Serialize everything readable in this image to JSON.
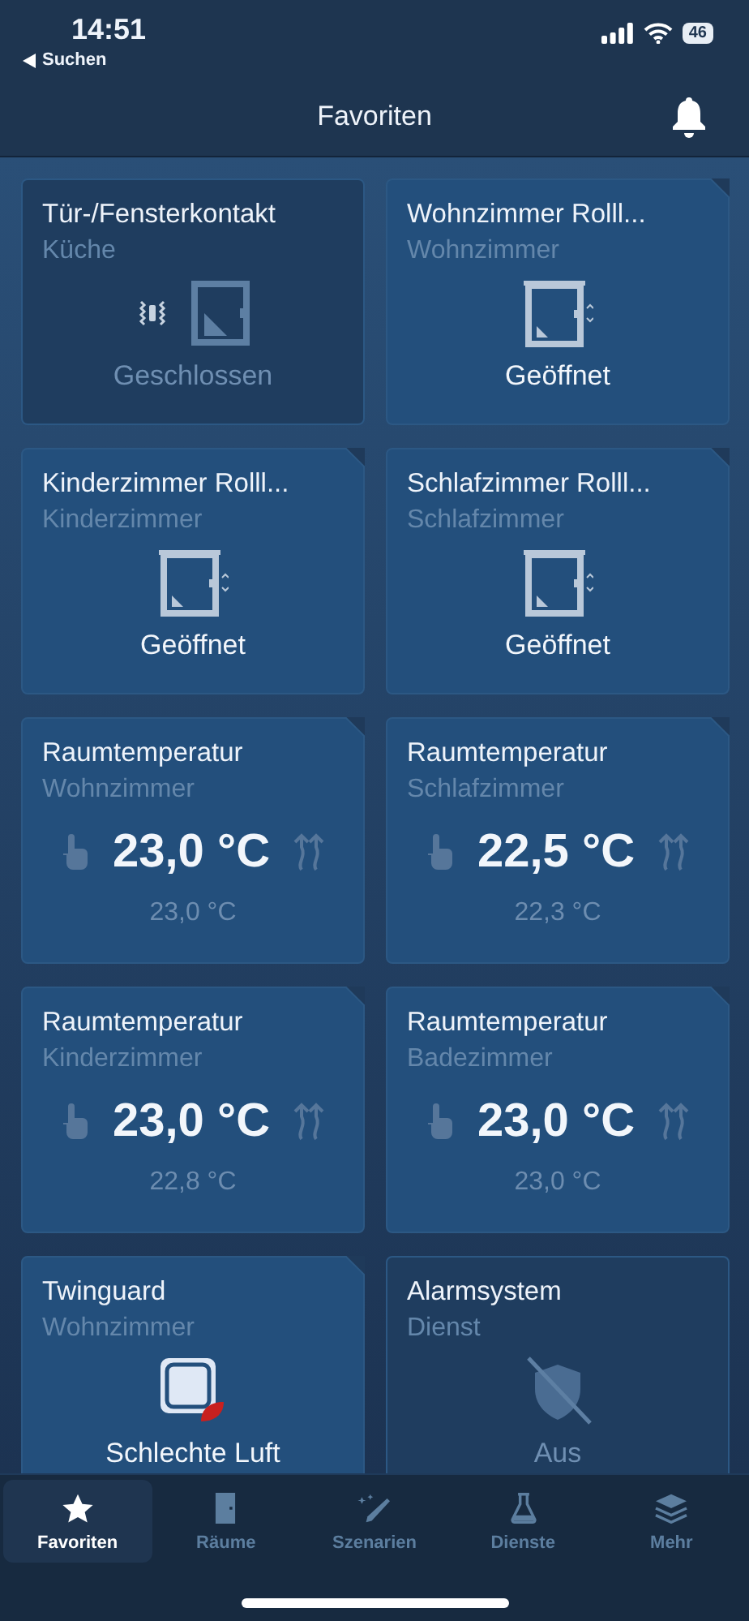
{
  "status_bar": {
    "time": "14:51",
    "back_label": "Suchen",
    "battery": "46"
  },
  "header": {
    "title": "Favoriten"
  },
  "cards": [
    {
      "kind": "contact",
      "title": "Tür-/Fensterkontakt",
      "room": "Küche",
      "status": "Geschlossen",
      "active": false
    },
    {
      "kind": "shutter",
      "title": "Wohnzimmer Rolll...",
      "room": "Wohnzimmer",
      "status": "Geöffnet",
      "active": true
    },
    {
      "kind": "shutter",
      "title": "Kinderzimmer Rolll...",
      "room": "Kinderzimmer",
      "status": "Geöffnet",
      "active": true
    },
    {
      "kind": "shutter",
      "title": "Schlafzimmer Rolll...",
      "room": "Schlafzimmer",
      "status": "Geöffnet",
      "active": true
    },
    {
      "kind": "thermostat",
      "title": "Raumtemperatur",
      "room": "Wohnzimmer",
      "setpoint": "23,0 °C",
      "status": "23,0 °C",
      "active": true
    },
    {
      "kind": "thermostat",
      "title": "Raumtemperatur",
      "room": "Schlafzimmer",
      "setpoint": "22,5 °C",
      "status": "22,3 °C",
      "active": true
    },
    {
      "kind": "thermostat",
      "title": "Raumtemperatur",
      "room": "Kinderzimmer",
      "setpoint": "23,0 °C",
      "status": "22,8 °C",
      "active": true
    },
    {
      "kind": "thermostat",
      "title": "Raumtemperatur",
      "room": "Badezimmer",
      "setpoint": "23,0 °C",
      "status": "23,0 °C",
      "active": true
    },
    {
      "kind": "twinguard",
      "title": "Twinguard",
      "room": "Wohnzimmer",
      "status": "Schlechte Luft",
      "active": true
    },
    {
      "kind": "alarm",
      "title": "Alarmsystem",
      "room": "Dienst",
      "status": "Aus",
      "active": false
    }
  ],
  "tabs": [
    {
      "kind": "star",
      "label": "Favoriten",
      "selected": true
    },
    {
      "kind": "door",
      "label": "Räume",
      "selected": false
    },
    {
      "kind": "wand",
      "label": "Szenarien",
      "selected": false
    },
    {
      "kind": "flask",
      "label": "Dienste",
      "selected": false
    },
    {
      "kind": "layers",
      "label": "Mehr",
      "selected": false
    }
  ]
}
